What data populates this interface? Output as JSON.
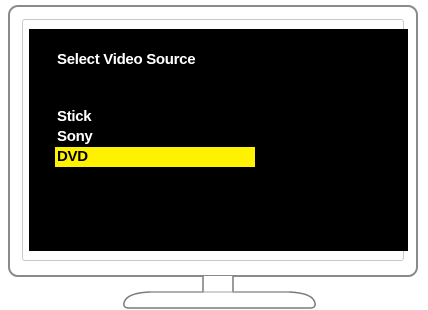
{
  "osd": {
    "title": "Select Video Source",
    "sources": [
      {
        "label": "Stick",
        "selected": false
      },
      {
        "label": "Sony",
        "selected": false
      },
      {
        "label": "DVD",
        "selected": true
      }
    ],
    "highlight_color": "#fff200",
    "screen_color": "#000000",
    "text_color": "#ffffff"
  }
}
